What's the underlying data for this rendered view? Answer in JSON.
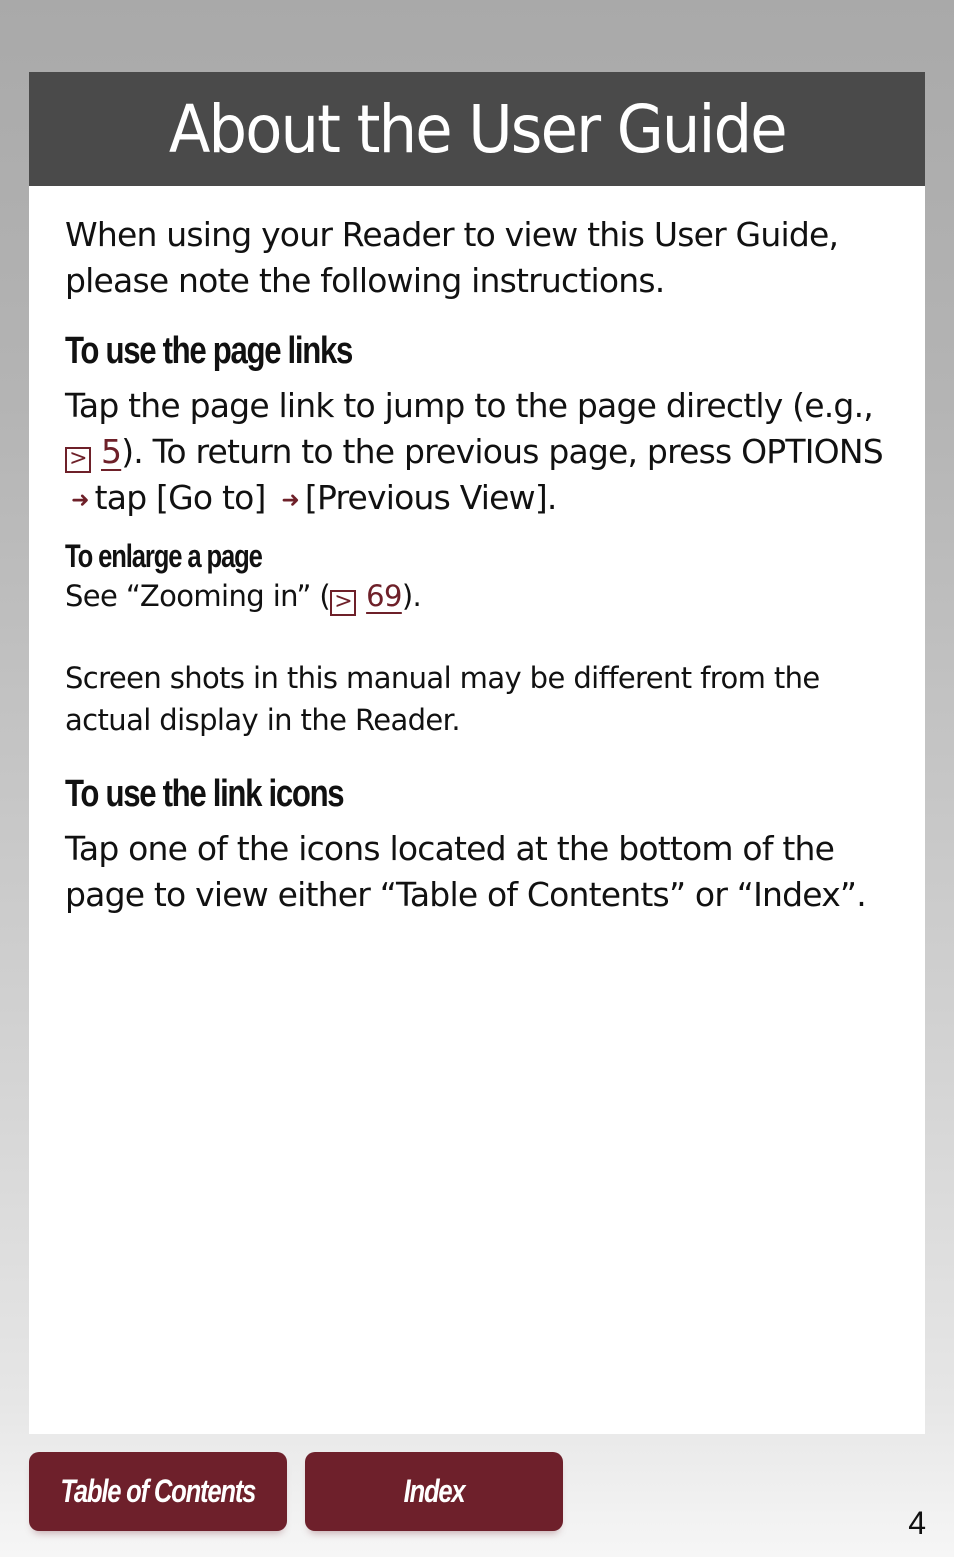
{
  "header": {
    "title": "About the User Guide"
  },
  "intro": "When using your Reader to view this User Guide, please note the following instructions.",
  "sections": {
    "page_links": {
      "heading": "To use the page links",
      "text_before": "Tap the page link to jump to the page directly (e.g.,",
      "link_page": "5",
      "text_after": "). To return to the previous page, press OPTIONS",
      "step2": "tap [Go to]",
      "step3": "[Previous View]."
    },
    "enlarge": {
      "heading": "To enlarge a page",
      "text_before": "See “Zooming in” (",
      "link_page": "69",
      "text_after": ")."
    },
    "note": "Screen shots in this manual may be different from the actual display in the Reader.",
    "link_icons": {
      "heading": "To use the link icons",
      "text": "Tap one of the icons located at the bottom of the page to view either “Table of Contents” or “Index”."
    }
  },
  "icons": {
    "page_link": "⊵",
    "arrow": "➜"
  },
  "footer": {
    "toc_label": "Table of Contents",
    "index_label": "Index",
    "page_number": "4"
  },
  "colors": {
    "accent": "#6e202b",
    "title_bar": "#4a4a4a"
  }
}
